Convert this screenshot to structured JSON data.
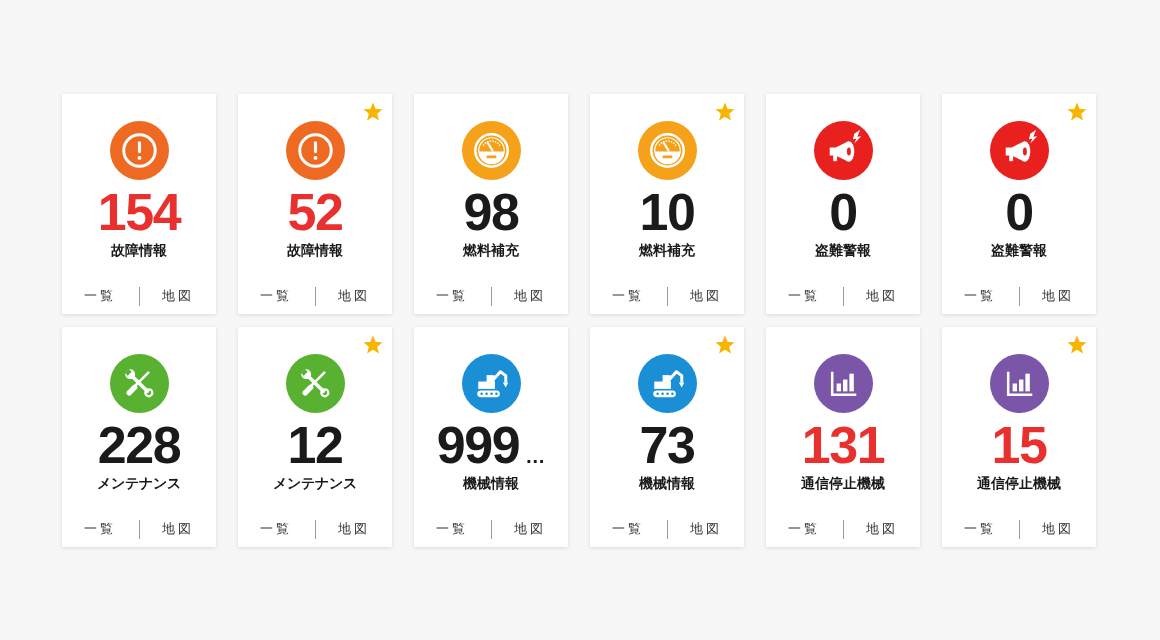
{
  "cards": [
    {
      "kind": "fault",
      "color": "#ee6a22",
      "starred": false,
      "count": "154",
      "alert": true,
      "label": "故障情報",
      "links": [
        "一覧",
        "地図"
      ]
    },
    {
      "kind": "fault",
      "color": "#ee6a22",
      "starred": true,
      "count": "52",
      "alert": true,
      "label": "故障情報",
      "links": [
        "一覧",
        "地図"
      ]
    },
    {
      "kind": "fuel",
      "color": "#f5a11a",
      "starred": false,
      "count": "98",
      "alert": false,
      "label": "燃料補充",
      "links": [
        "一覧",
        "地図"
      ]
    },
    {
      "kind": "fuel",
      "color": "#f5a11a",
      "starred": true,
      "count": "10",
      "alert": false,
      "label": "燃料補充",
      "links": [
        "一覧",
        "地図"
      ]
    },
    {
      "kind": "theft",
      "color": "#e8211e",
      "starred": false,
      "count": "0",
      "alert": false,
      "label": "盗難警報",
      "links": [
        "一覧",
        "地図"
      ]
    },
    {
      "kind": "theft",
      "color": "#e8211e",
      "starred": true,
      "count": "0",
      "alert": false,
      "label": "盗難警報",
      "links": [
        "一覧",
        "地図"
      ]
    },
    {
      "kind": "maintenance",
      "color": "#58b131",
      "starred": false,
      "count": "228",
      "alert": false,
      "label": "メンテナンス",
      "links": [
        "一覧",
        "地図"
      ]
    },
    {
      "kind": "maintenance",
      "color": "#58b131",
      "starred": true,
      "count": "12",
      "alert": false,
      "label": "メンテナンス",
      "links": [
        "一覧",
        "地図"
      ]
    },
    {
      "kind": "machine",
      "color": "#1a8fd5",
      "starred": false,
      "count": "999",
      "count_suffix": "…",
      "alert": false,
      "label": "機械情報",
      "links": [
        "一覧",
        "地図"
      ]
    },
    {
      "kind": "machine",
      "color": "#1a8fd5",
      "starred": true,
      "count": "73",
      "alert": false,
      "label": "機械情報",
      "links": [
        "一覧",
        "地図"
      ]
    },
    {
      "kind": "comm",
      "color": "#7b55a7",
      "starred": false,
      "count": "131",
      "alert": true,
      "label": "通信停止機械",
      "links": [
        "一覧",
        "地図"
      ]
    },
    {
      "kind": "comm",
      "color": "#7b55a7",
      "starred": true,
      "count": "15",
      "alert": true,
      "label": "通信停止機械",
      "links": [
        "一覧",
        "地図"
      ]
    }
  ]
}
